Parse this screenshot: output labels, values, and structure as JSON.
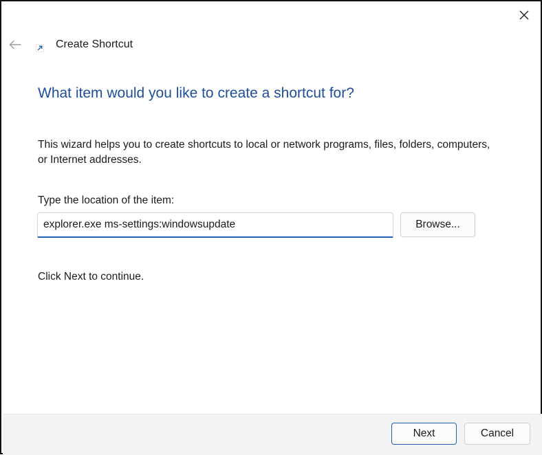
{
  "window": {
    "title": "Create Shortcut"
  },
  "icons": {
    "close": "close-icon",
    "back": "back-arrow-icon",
    "app": "shortcut-icon"
  },
  "heading": "What item would you like to create a shortcut for?",
  "description": "This wizard helps you to create shortcuts to local or network programs, files, folders, computers, or Internet addresses.",
  "location": {
    "label": "Type the location of the item:",
    "value": "explorer.exe ms-settings:windowsupdate",
    "browse_label": "Browse..."
  },
  "continue_text": "Click Next to continue.",
  "footer": {
    "next_label": "Next",
    "cancel_label": "Cancel"
  },
  "colors": {
    "heading": "#1e4e9a",
    "accent": "#1f5fb4",
    "footer_bg": "#f3f3f3"
  }
}
